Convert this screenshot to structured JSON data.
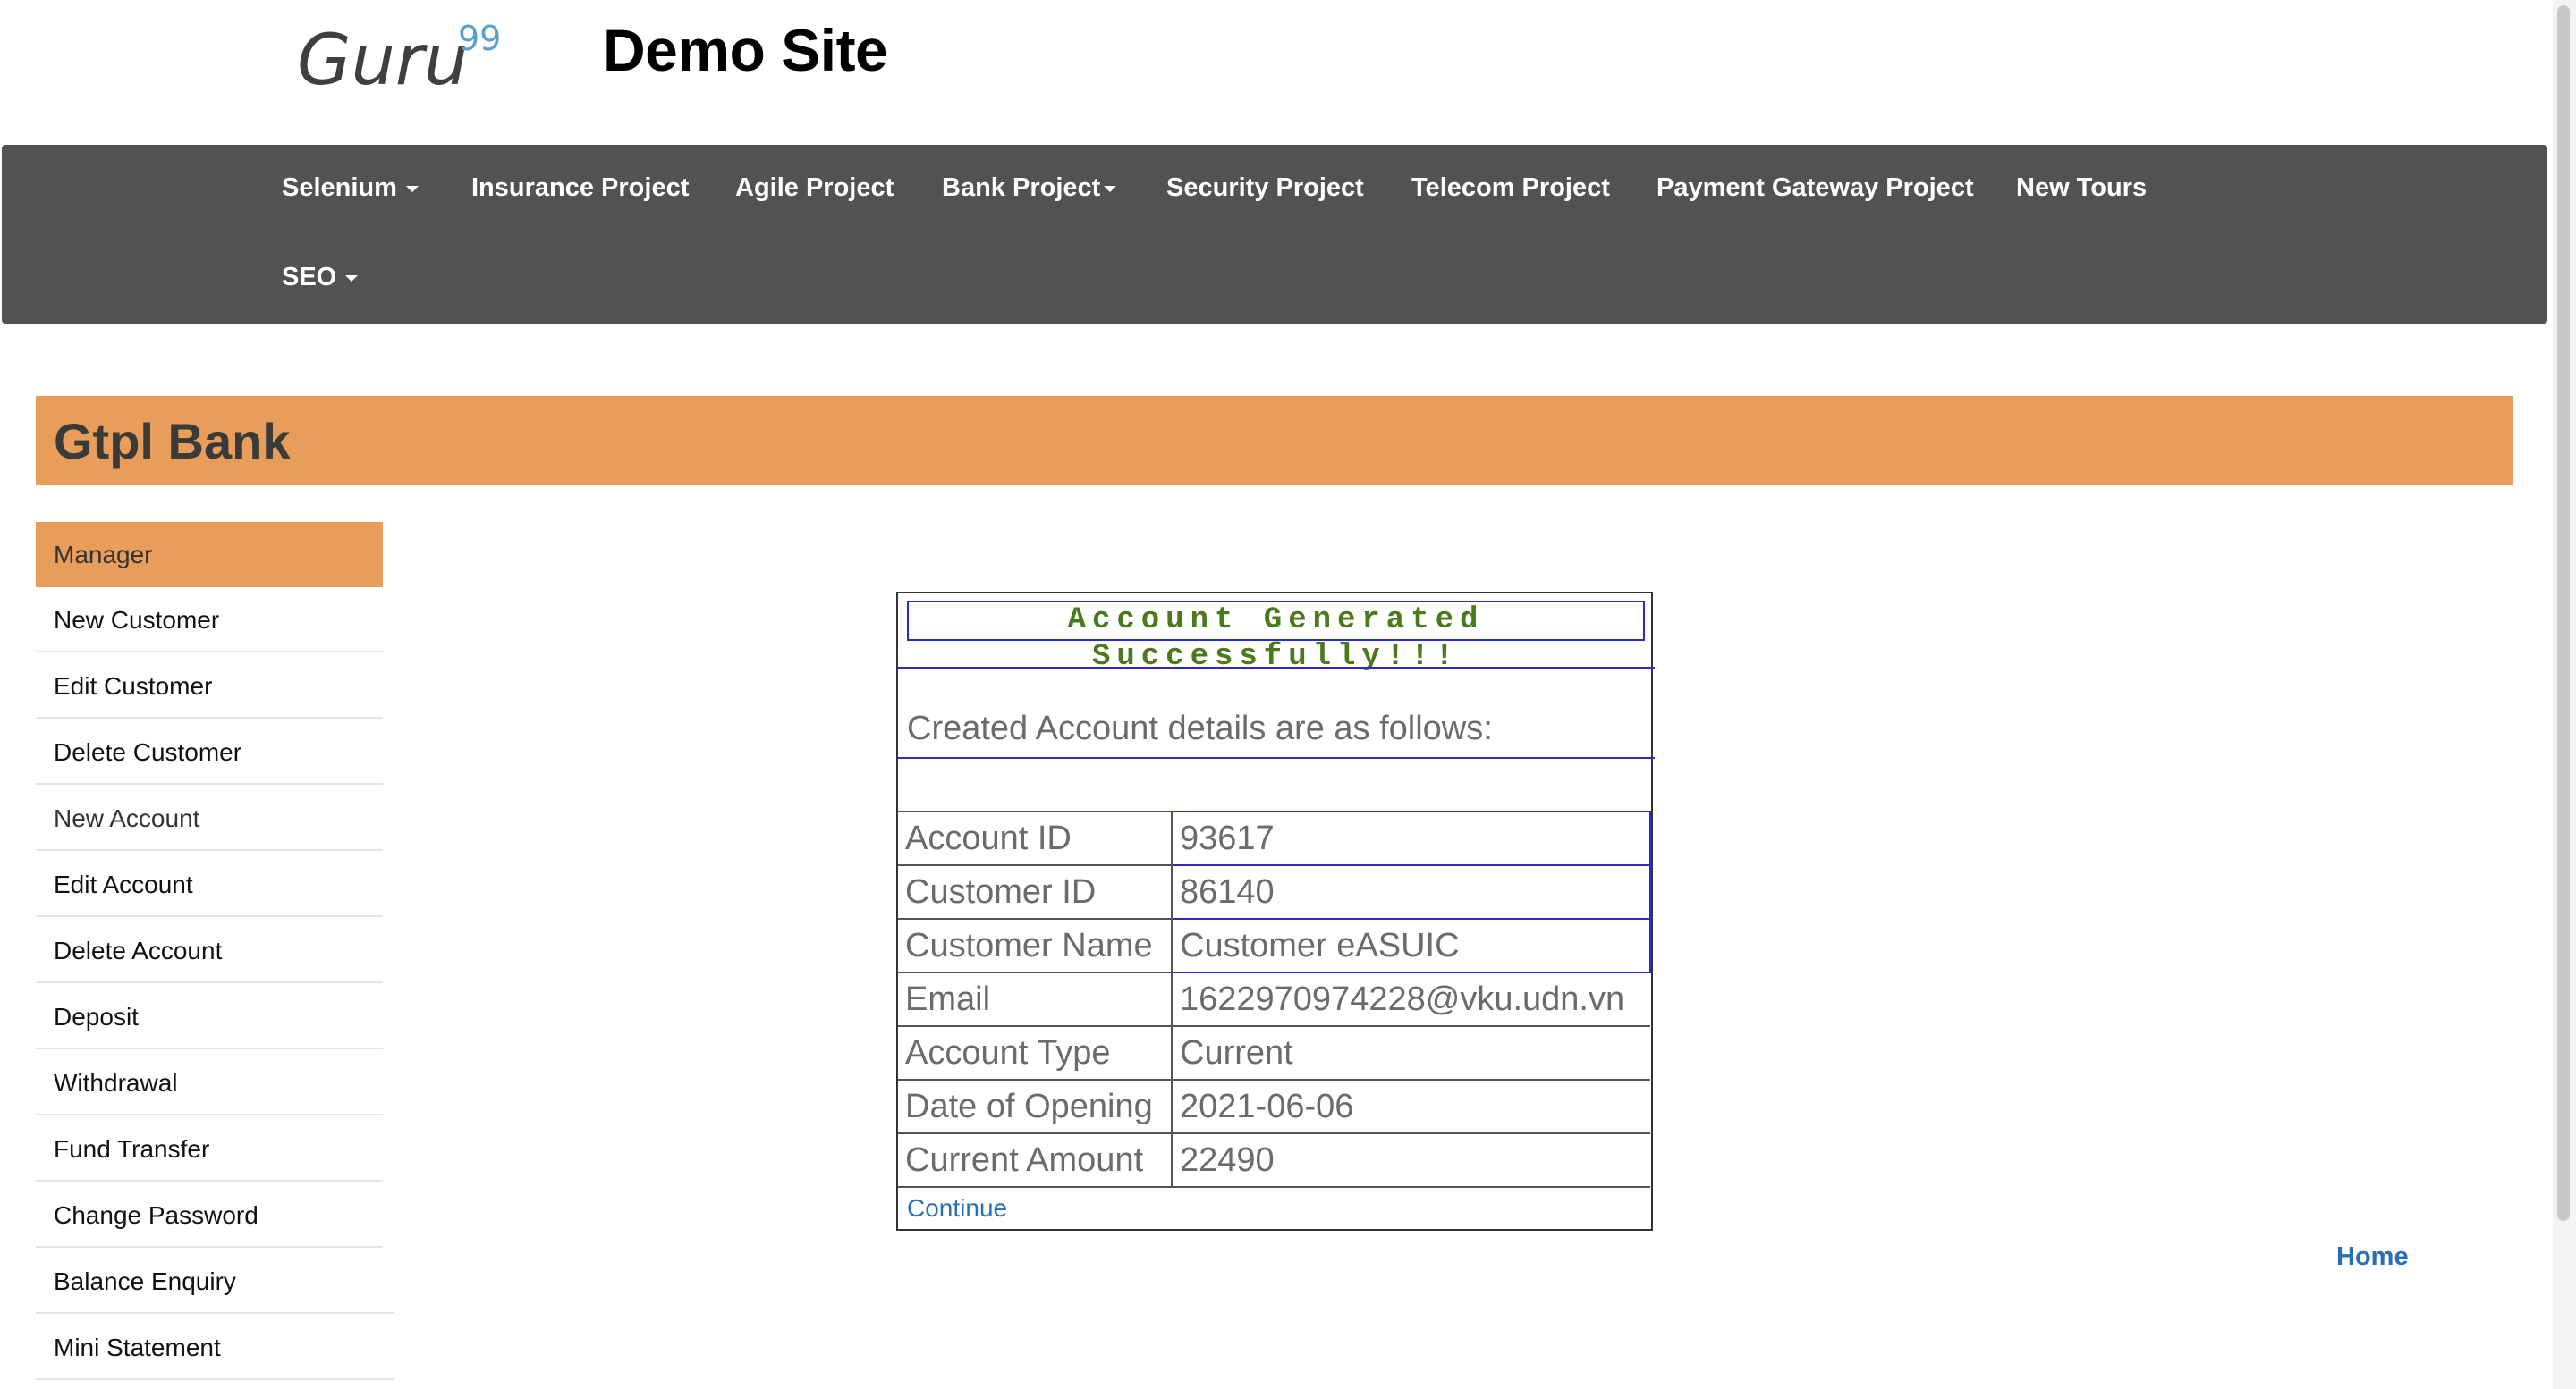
{
  "header": {
    "logo_text": "Guru",
    "logo_sup": "99",
    "title": "Demo Site"
  },
  "nav": {
    "items": [
      {
        "label": "Selenium",
        "dropdown": true
      },
      {
        "label": "Insurance Project",
        "dropdown": false
      },
      {
        "label": "Agile Project",
        "dropdown": false
      },
      {
        "label": "Bank Project",
        "dropdown": true
      },
      {
        "label": "Security Project",
        "dropdown": false
      },
      {
        "label": "Telecom Project",
        "dropdown": false
      },
      {
        "label": "Payment Gateway Project",
        "dropdown": false
      },
      {
        "label": "New Tours",
        "dropdown": false
      },
      {
        "label": "SEO",
        "dropdown": true
      }
    ]
  },
  "bank": {
    "title": "Gtpl Bank"
  },
  "sidebar": {
    "items": [
      {
        "label": "Manager"
      },
      {
        "label": "New Customer"
      },
      {
        "label": "Edit Customer"
      },
      {
        "label": "Delete Customer"
      },
      {
        "label": "New Account"
      },
      {
        "label": "Edit Account"
      },
      {
        "label": "Delete Account"
      },
      {
        "label": "Deposit"
      },
      {
        "label": "Withdrawal"
      },
      {
        "label": "Fund Transfer"
      },
      {
        "label": "Change Password"
      },
      {
        "label": "Balance Enquiry"
      },
      {
        "label": "Mini Statement"
      }
    ]
  },
  "account": {
    "success_message": "Account Generated Successfully!!!",
    "subheading": "Created Account details are as follows:",
    "rows": [
      {
        "label": "Account ID",
        "value": "93617"
      },
      {
        "label": "Customer ID",
        "value": "86140"
      },
      {
        "label": "Customer Name",
        "value": "Customer eASUIC"
      },
      {
        "label": "Email",
        "value": "1622970974228@vku.udn.vn"
      },
      {
        "label": "Account Type",
        "value": "Current"
      },
      {
        "label": "Date of Opening",
        "value": "2021-06-06"
      },
      {
        "label": "Current Amount",
        "value": "22490"
      }
    ],
    "continue_label": "Continue"
  },
  "footer": {
    "home_label": "Home"
  },
  "colors": {
    "nav_bg": "#525252",
    "accent_orange": "#e99d5a",
    "success_green": "#4b7a1c",
    "link_blue": "#2a6fb5",
    "border_blue": "#2c2cc4"
  }
}
